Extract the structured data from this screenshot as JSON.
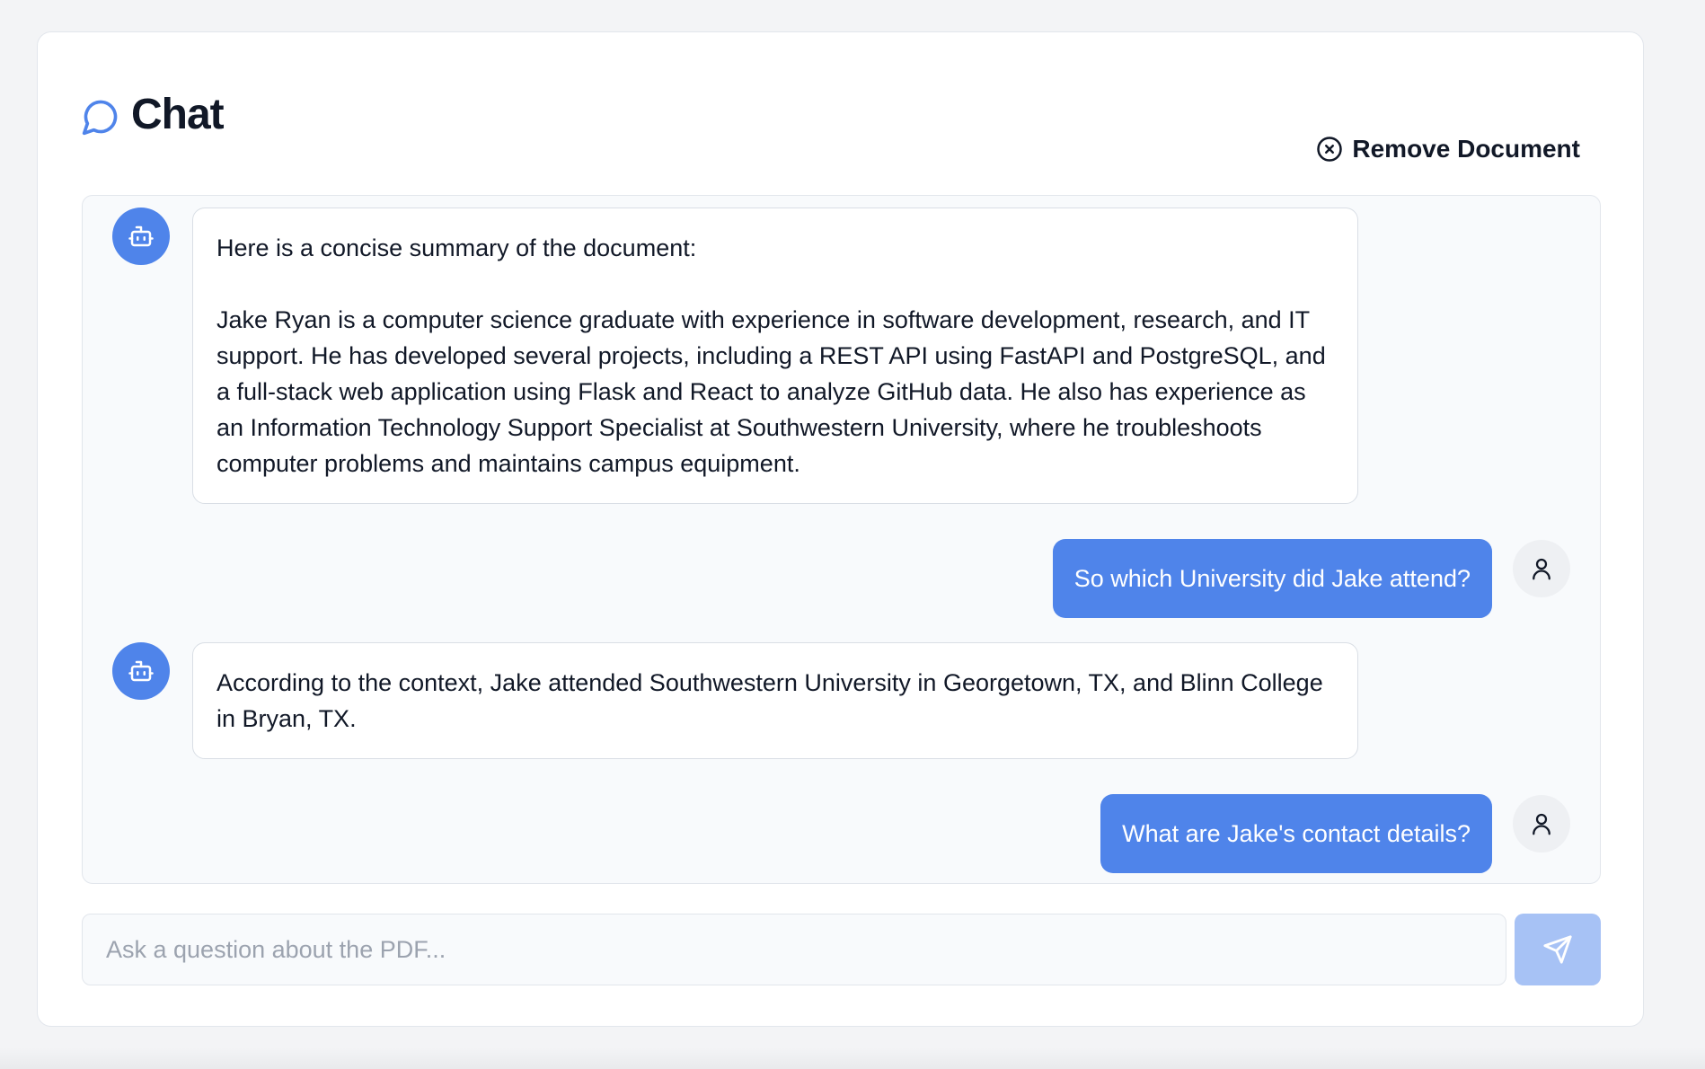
{
  "header": {
    "title": "Chat",
    "remove_label": "Remove Document"
  },
  "messages": [
    {
      "role": "bot",
      "paragraphs": [
        "Here is a concise summary of the document:",
        "Jake Ryan is a computer science graduate with experience in software development, research, and IT support. He has developed several projects, including a REST API using FastAPI and PostgreSQL, and a full-stack web application using Flask and React to analyze GitHub data. He also has experience as an Information Technology Support Specialist at Southwestern University, where he troubleshoots computer problems and maintains campus equipment."
      ]
    },
    {
      "role": "user",
      "text": "So which University did Jake attend?"
    },
    {
      "role": "bot",
      "paragraphs": [
        "According to the context, Jake attended Southwestern University in Georgetown, TX, and Blinn College in Bryan, TX."
      ]
    },
    {
      "role": "user",
      "text": "What are Jake's contact details?"
    }
  ],
  "input": {
    "placeholder": "Ask a question about the PDF...",
    "value": ""
  },
  "colors": {
    "accent": "#4f84ea",
    "send_disabled": "#a7c2f5"
  },
  "icons": {
    "header": "message-circle-icon",
    "remove": "x-circle-icon",
    "bot": "bot-icon",
    "user": "user-icon",
    "send": "send-icon"
  }
}
